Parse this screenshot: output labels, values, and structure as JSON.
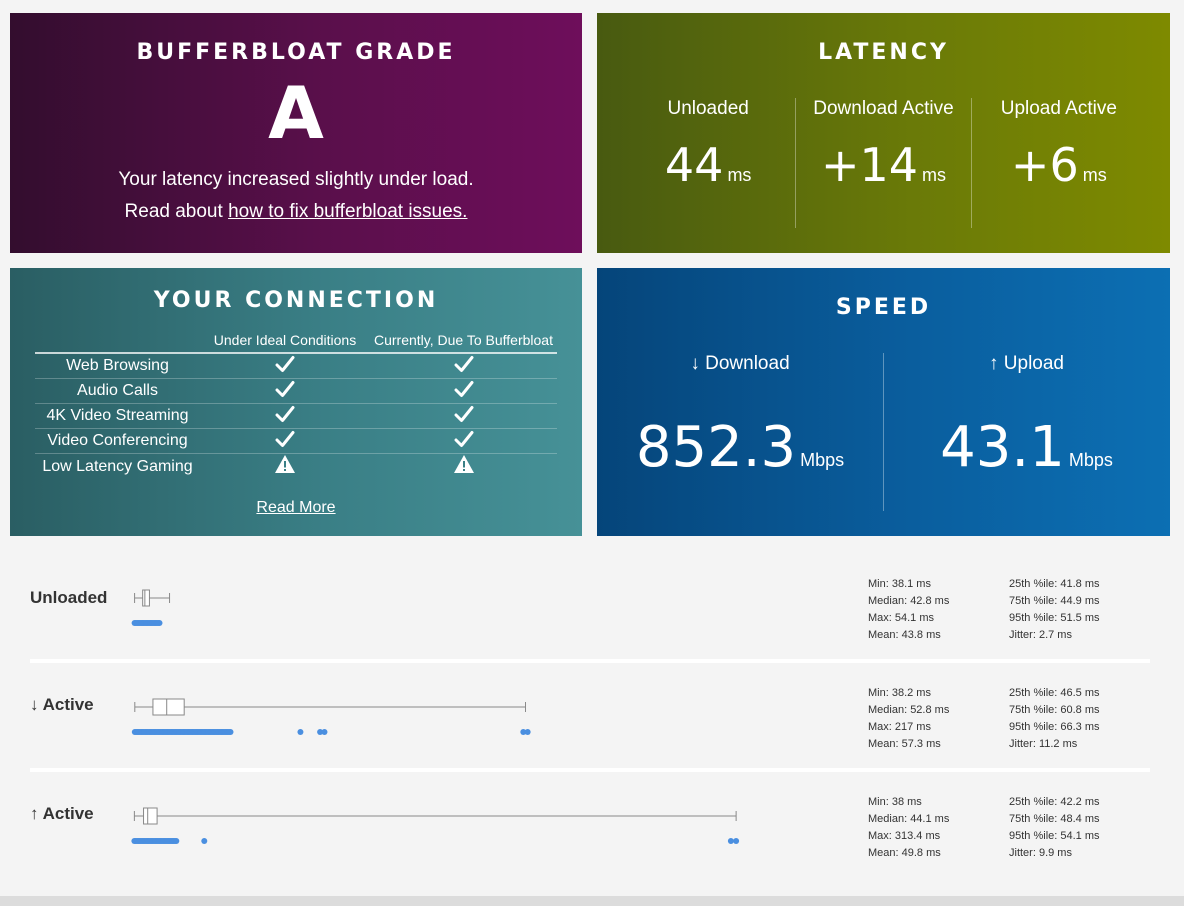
{
  "grade": {
    "title": "BUFFERBLOAT GRADE",
    "letter": "A",
    "line1": "Your latency increased slightly under load.",
    "line2_prefix": "Read about ",
    "line2_link": "how to fix bufferbloat issues."
  },
  "latency": {
    "title": "LATENCY",
    "columns": [
      {
        "label": "Unloaded",
        "value": "44",
        "unit": "ms"
      },
      {
        "label": "Download Active",
        "value": "+14",
        "unit": "ms"
      },
      {
        "label": "Upload Active",
        "value": "+6",
        "unit": "ms"
      }
    ]
  },
  "connection": {
    "title": "YOUR CONNECTION",
    "headers": [
      "",
      "Under Ideal Conditions",
      "Currently, Due To Bufferbloat"
    ],
    "rows": [
      {
        "label": "Web Browsing",
        "ideal": "check",
        "current": "check"
      },
      {
        "label": "Audio Calls",
        "ideal": "check",
        "current": "check"
      },
      {
        "label": "4K Video Streaming",
        "ideal": "check",
        "current": "check"
      },
      {
        "label": "Video Conferencing",
        "ideal": "check",
        "current": "check"
      },
      {
        "label": "Low Latency Gaming",
        "ideal": "warning",
        "current": "warning"
      }
    ],
    "read_more": "Read More"
  },
  "speed": {
    "title": "SPEED",
    "download": {
      "label": "↓ Download",
      "value": "852.3",
      "unit": "Mbps"
    },
    "upload": {
      "label": "↑ Upload",
      "value": "43.1",
      "unit": "Mbps"
    }
  },
  "boxplots": [
    {
      "label": "Unloaded",
      "stats_left": [
        "Min: 38.1 ms",
        "Median: 42.8 ms",
        "Max: 54.1 ms",
        "Mean: 43.8 ms"
      ],
      "stats_right": [
        "25th %ile: 41.8 ms",
        "75th %ile: 44.9 ms",
        "95th %ile: 51.5 ms",
        "Jitter: 2.7 ms"
      ],
      "min": 38.1,
      "q1": 41.8,
      "median": 42.8,
      "q3": 44.9,
      "max": 54.1,
      "outliers": []
    },
    {
      "label": "↓ Active",
      "stats_left": [
        "Min: 38.2 ms",
        "Median: 52.8 ms",
        "Max: 217 ms",
        "Mean: 57.3 ms"
      ],
      "stats_right": [
        "25th %ile: 46.5 ms",
        "75th %ile: 60.8 ms",
        "95th %ile: 66.3 ms",
        "Jitter: 11.2 ms"
      ],
      "min": 38.2,
      "q1": 46.5,
      "median": 52.8,
      "q3": 60.8,
      "max": 217,
      "outliers": [
        114,
        123,
        125,
        216,
        218
      ]
    },
    {
      "label": "↑ Active",
      "stats_left": [
        "Min: 38 ms",
        "Median: 44.1 ms",
        "Max: 313.4 ms",
        "Mean: 49.8 ms"
      ],
      "stats_right": [
        "25th %ile: 42.2 ms",
        "75th %ile: 48.4 ms",
        "95th %ile: 54.1 ms",
        "Jitter: 9.9 ms"
      ],
      "min": 38,
      "q1": 42.2,
      "median": 44.1,
      "q3": 48.4,
      "max": 313.4,
      "outliers": [
        70,
        311,
        313.4
      ]
    }
  ],
  "colors": {
    "dot": "#4a8fe0",
    "box_stroke": "#888888"
  }
}
